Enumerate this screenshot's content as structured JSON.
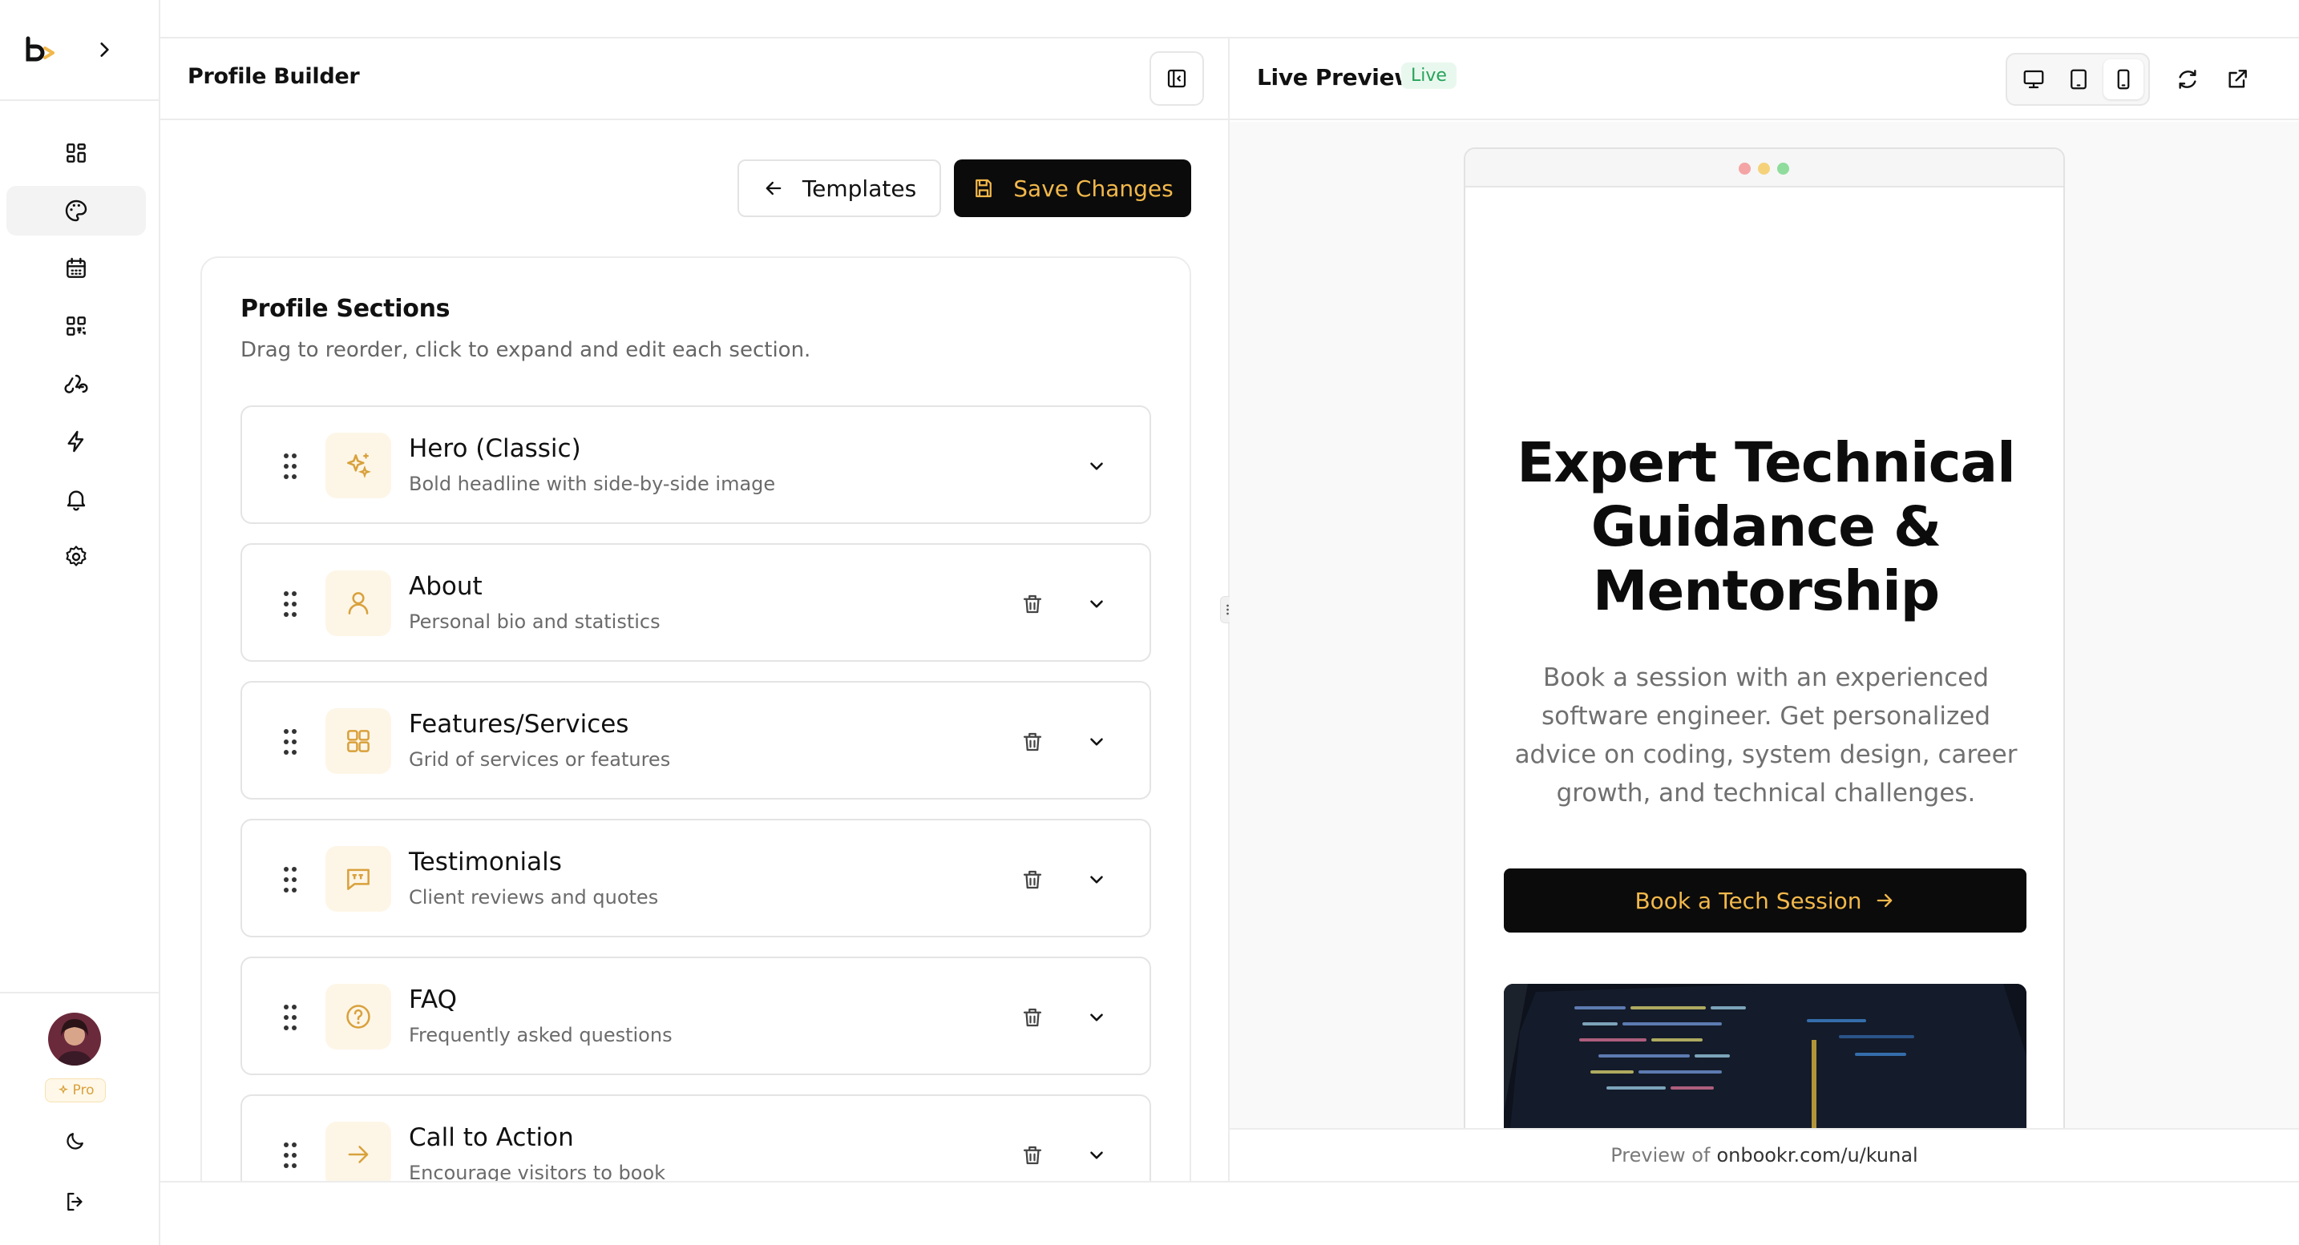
{
  "sidebar": {
    "logo": "onbookr-logo",
    "expand_icon": "chevron-right-icon",
    "nav": [
      {
        "id": "dashboard",
        "icon": "grid-icon"
      },
      {
        "id": "profile-builder",
        "icon": "palette-icon",
        "active": true
      },
      {
        "id": "calendar",
        "icon": "calendar-icon"
      },
      {
        "id": "qr-code",
        "icon": "qr-code-icon"
      },
      {
        "id": "webhooks",
        "icon": "webhook-icon"
      },
      {
        "id": "integrations",
        "icon": "lightning-icon"
      },
      {
        "id": "notifications",
        "icon": "bell-icon"
      },
      {
        "id": "settings",
        "icon": "gear-icon"
      }
    ],
    "pro_label": "Pro",
    "theme_icon": "moon-icon",
    "logout_icon": "logout-icon"
  },
  "editor": {
    "title": "Profile Builder",
    "templates_label": "Templates",
    "save_label": "Save Changes",
    "sections_title": "Profile Sections",
    "sections_desc": "Drag to reorder, click to expand and edit each section.",
    "sections": [
      {
        "title": "Hero (Classic)",
        "subtitle": "Bold headline with side-by-side image",
        "icon": "sparkles-icon",
        "deletable": false
      },
      {
        "title": "About",
        "subtitle": "Personal bio and statistics",
        "icon": "user-icon",
        "deletable": true
      },
      {
        "title": "Features/Services",
        "subtitle": "Grid of services or features",
        "icon": "grid-icon",
        "deletable": true
      },
      {
        "title": "Testimonials",
        "subtitle": "Client reviews and quotes",
        "icon": "quote-icon",
        "deletable": true
      },
      {
        "title": "FAQ",
        "subtitle": "Frequently asked questions",
        "icon": "help-circle-icon",
        "deletable": true
      },
      {
        "title": "Call to Action",
        "subtitle": "Encourage visitors to book",
        "icon": "arrow-right-icon",
        "deletable": true
      }
    ]
  },
  "preview": {
    "title": "Live Preview",
    "badge": "Live",
    "devices": [
      "desktop-icon",
      "tablet-icon",
      "mobile-icon"
    ],
    "active_device": "mobile",
    "hero_title": "Expert Technical Guidance & Mentorship",
    "hero_subtitle": "Book a session with an experienced software engineer. Get personalized advice on coding, system design, career growth, and technical challenges.",
    "cta_label": "Book a Tech Session",
    "footer_prefix": "Preview of",
    "footer_url": "onbookr.com/u/kunal"
  },
  "colors": {
    "accent": "#f2b84b",
    "dark": "#0b0b0b",
    "live_green": "#27a35a",
    "icon_bg": "#fdf6e7"
  }
}
